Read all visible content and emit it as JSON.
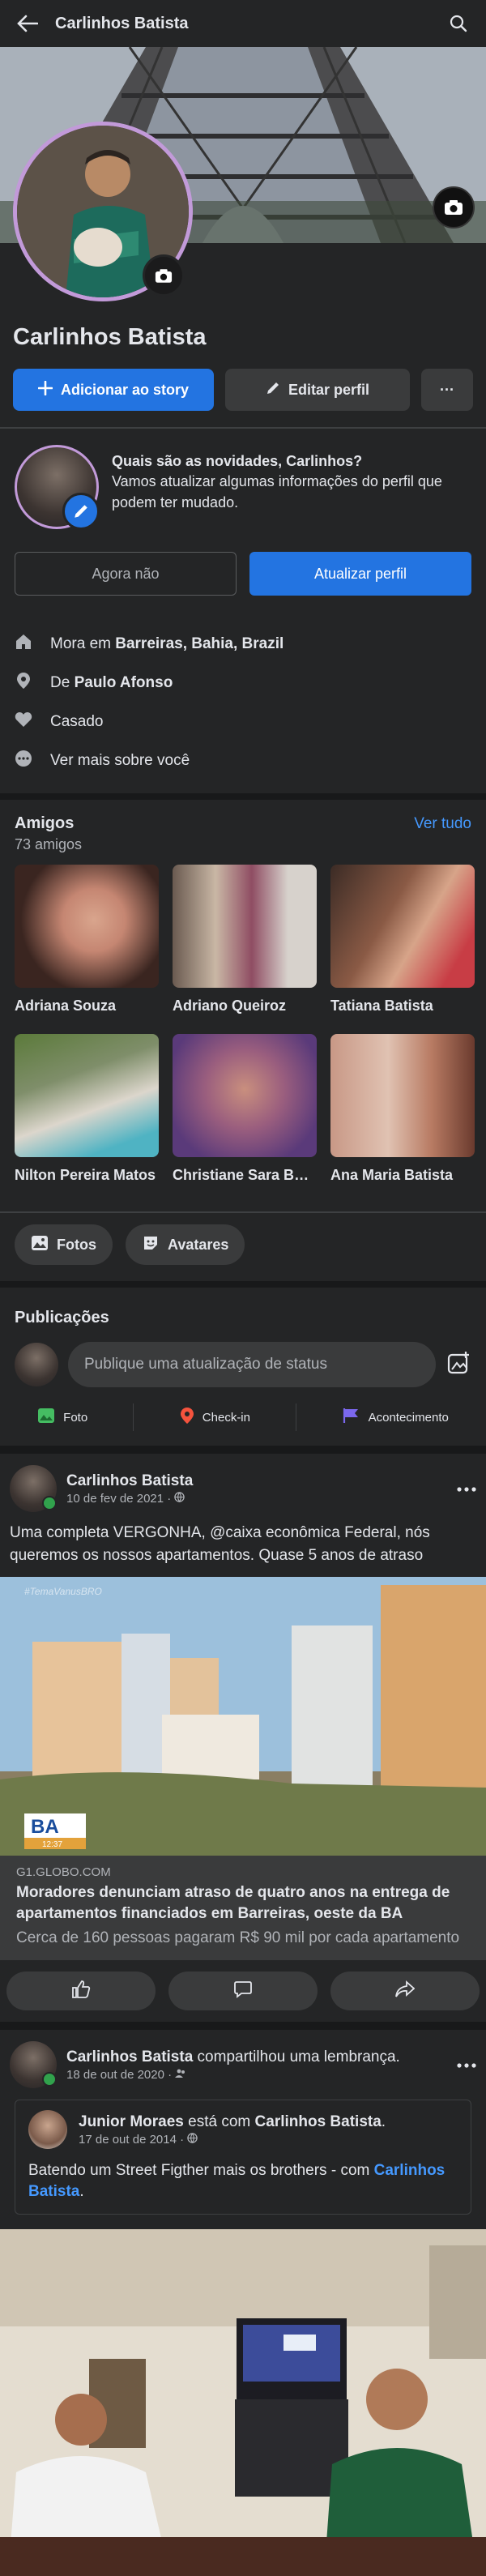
{
  "header": {
    "title": "Carlinhos Batista",
    "back_icon": "arrow-left-icon",
    "search_icon": "search-icon"
  },
  "profile": {
    "name": "Carlinhos Batista",
    "add_story_label": "Adicionar ao story",
    "edit_profile_label": "Editar perfil",
    "more_label": "···"
  },
  "update_prompt": {
    "title": "Quais são as novidades, Carlinhos?",
    "body": "Vamos atualizar algumas informações do perfil que podem ter mudado.",
    "dismiss_label": "Agora não",
    "update_label": "Atualizar perfil"
  },
  "about": {
    "lives_prefix": "Mora em ",
    "lives_value": "Barreiras, Bahia, Brazil",
    "from_prefix": "De ",
    "from_value": "Paulo Afonso",
    "relationship": "Casado",
    "see_more": "Ver mais sobre você"
  },
  "friends": {
    "title": "Amigos",
    "count": "73 amigos",
    "see_all": "Ver tudo",
    "items": [
      {
        "name": "Adriana Souza"
      },
      {
        "name": "Adriano Queiroz"
      },
      {
        "name": "Tatiana Batista"
      },
      {
        "name": "Nilton Pereira Matos"
      },
      {
        "name": "Christiane Sara Batista"
      },
      {
        "name": "Ana Maria Batista"
      }
    ]
  },
  "chips": {
    "photos": "Fotos",
    "avatars": "Avatares"
  },
  "publications": {
    "title": "Publicações",
    "placeholder": "Publique uma atualização de status",
    "photo": "Foto",
    "checkin": "Check-in",
    "event": "Acontecimento"
  },
  "post1": {
    "author": "Carlinhos Batista",
    "date": "10 de fev de 2021 ·",
    "text": "Uma completa VERGONHA, @caixa econômica Federal,  nós queremos os nossos apartamentos. Quase 5 anos de atraso",
    "image_overlay": "#TemaVanusBRO",
    "tv_badge": "BA",
    "tv_time": "12:37",
    "link_domain": "G1.GLOBO.COM",
    "link_title": "Moradores denunciam atraso de quatro anos na entrega de apartamentos financiados em Barreiras, oeste da BA",
    "link_desc": "Cerca de 160 pessoas pagaram R$ 90 mil por cada apartamento"
  },
  "post2": {
    "author": "Carlinhos Batista",
    "action": " compartilhou uma lembrança.",
    "date": "18 de out de 2020 ·",
    "memory_author": "Junior Moraes",
    "memory_with": " está com ",
    "memory_tagged": "Carlinhos Batista",
    "memory_date": "17 de out de 2014 ·",
    "memory_text": "Batendo um Street Figther mais os brothers - com ",
    "memory_text_tag": "Carlinhos Batista",
    "memory_text_end": "."
  },
  "colors": {
    "background": "#18191a",
    "surface": "#242526",
    "accent": "#2374e1",
    "link": "#4599ff"
  }
}
